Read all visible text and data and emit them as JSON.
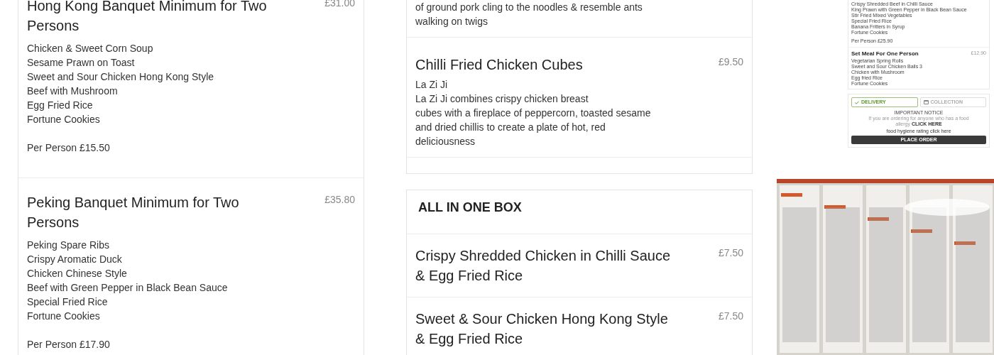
{
  "left_column": {
    "items": [
      {
        "name": "Hong Kong Banquet Minimum for Two Persons",
        "price": "£31.00",
        "description_lines": [
          "Chicken & Sweet Corn Soup",
          "Sesame Prawn on Toast",
          "Sweet and Sour Chicken Hong Kong Style",
          "Beef with Mushroom",
          "Egg Fried Rice",
          "Fortune Cookies"
        ],
        "per_person": "Per Person £15.50"
      },
      {
        "name": "Peking Banquet Minimum for Two Persons",
        "price": "£35.80",
        "description_lines": [
          "Peking Spare Ribs",
          "Crispy Aromatic Duck",
          "Chicken Chinese Style",
          "Beef with Green Pepper in Black Bean Sauce",
          "Special Fried Rice",
          "Fortune Cookies"
        ],
        "per_person": "Per Person £17.90"
      }
    ]
  },
  "middle_column": {
    "partial_item": {
      "description_lines": [
        "of ground pork cling to the noodles & resemble ants",
        "walking on twigs"
      ]
    },
    "items": [
      {
        "name": "Chilli Fried Chicken Cubes",
        "price": "£9.50",
        "description_lines": [
          "La Zi Ji",
          "La Zi Ji combines crispy chicken breast",
          "cubes with a fireplace of peppercorn, toasted sesame",
          "and dried chillis to create a plate of hot, red",
          "deliciousness"
        ]
      }
    ],
    "section": {
      "title": "ALL IN ONE BOX",
      "items": [
        {
          "name": "Crispy Shredded Chicken in Chilli Sauce & Egg Fried Rice",
          "price": "£7.50"
        },
        {
          "name": "Sweet & Sour Chicken Hong Kong Style & Egg Fried Rice",
          "price": "£7.50"
        }
      ]
    }
  },
  "sidebar": {
    "banquet_tail": {
      "description_lines": [
        "Crispy Shredded Beef in Chilli Sauce",
        "King Prawn with Green Pepper in Black Bean Sauce",
        "Stir Fried Mixed Vegetables",
        "Special Fried Rice",
        "Banana Fritters in Syrup",
        "Fortune Cookies"
      ],
      "per_person": "Per Person £25.90"
    },
    "set_meal": {
      "name": "Set Meal For One Person",
      "price": "£12.90",
      "description_lines": [
        "Vegetarian Spring Rolls",
        "Sweet and Sour Chicken Balls 3",
        "Chicken with Mushroom",
        "Egg fried Rice",
        "Fortune Cookies"
      ]
    },
    "order": {
      "options": [
        {
          "kind": "delivery",
          "label": "DELIVERY",
          "selected": true
        },
        {
          "kind": "collection",
          "label": "COLLECTION",
          "selected": false
        }
      ],
      "notice_title": "IMPORTANT NOTICE",
      "notice_text": "If you are ordering for anyone who has a food allergy",
      "notice_link": "CLICK HERE",
      "hygiene_link": "food hygiene rating click here",
      "place_order": "PLACE ORDER"
    }
  }
}
